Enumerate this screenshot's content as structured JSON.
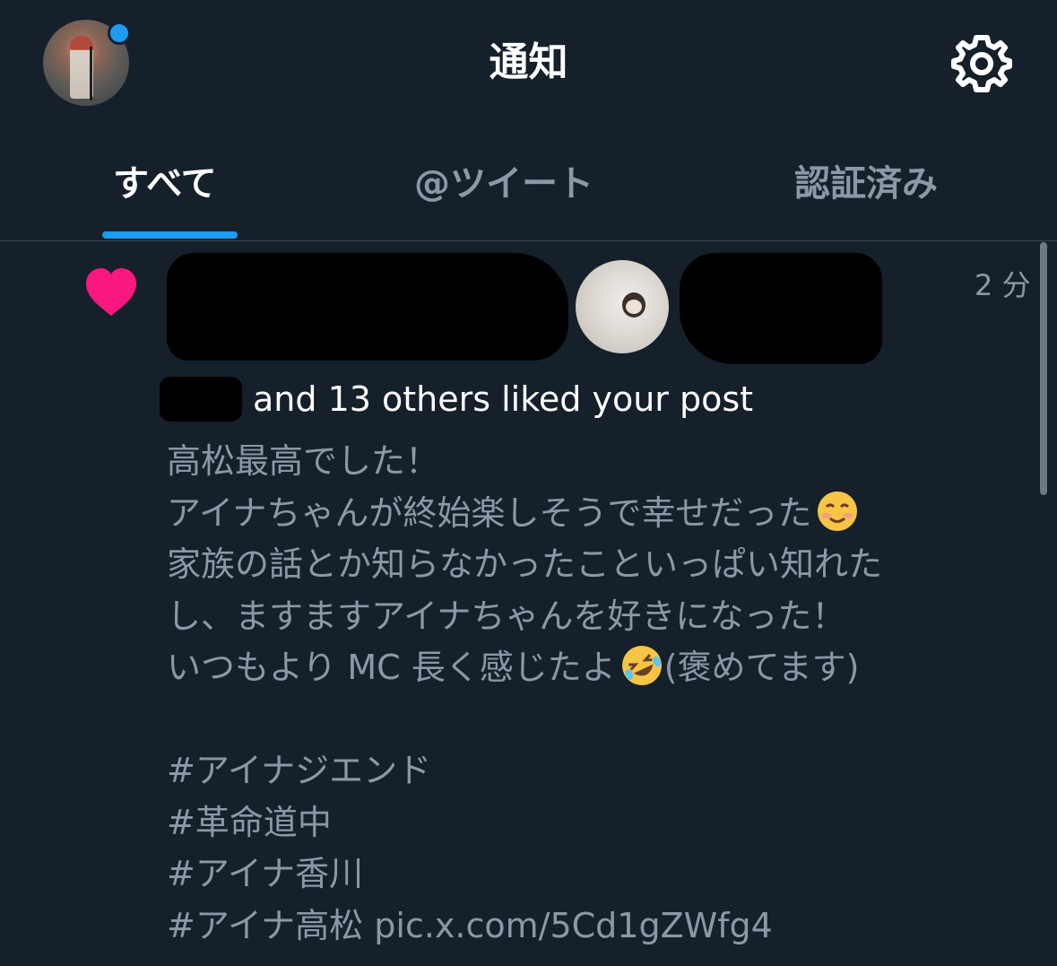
{
  "header": {
    "title": "通知",
    "avatar_icon": "user-avatar",
    "avatar_dot_color": "#1d9bf0",
    "settings_icon": "gear-icon"
  },
  "tabs": [
    {
      "label": "すべて",
      "active": true
    },
    {
      "label": "@ツイート",
      "active": false
    },
    {
      "label": "認証済み",
      "active": false
    }
  ],
  "notification": {
    "type_icon": "heart-icon",
    "type_color": "#f91880",
    "time": "2 分",
    "summary": "and 13 others liked your post",
    "post_lines": [
      "高松最高でした！",
      "アイナちゃんが終始楽しそうで幸せだった",
      "家族の話とか知らなかったこといっぱい知れた",
      "し、ますますアイナちゃんを好きになった！",
      "いつもより MC 長く感じたよ",
      "(褒めてます)",
      "#アイナジエンド",
      "#革命道中",
      "#アイナ香川",
      "#アイナ高松 pic.x.com/5Cd1gZWfg4"
    ]
  },
  "colors": {
    "background": "#15202b",
    "accent": "#1d9bf0",
    "muted_text": "#8b98a5",
    "divider": "#38444d"
  }
}
